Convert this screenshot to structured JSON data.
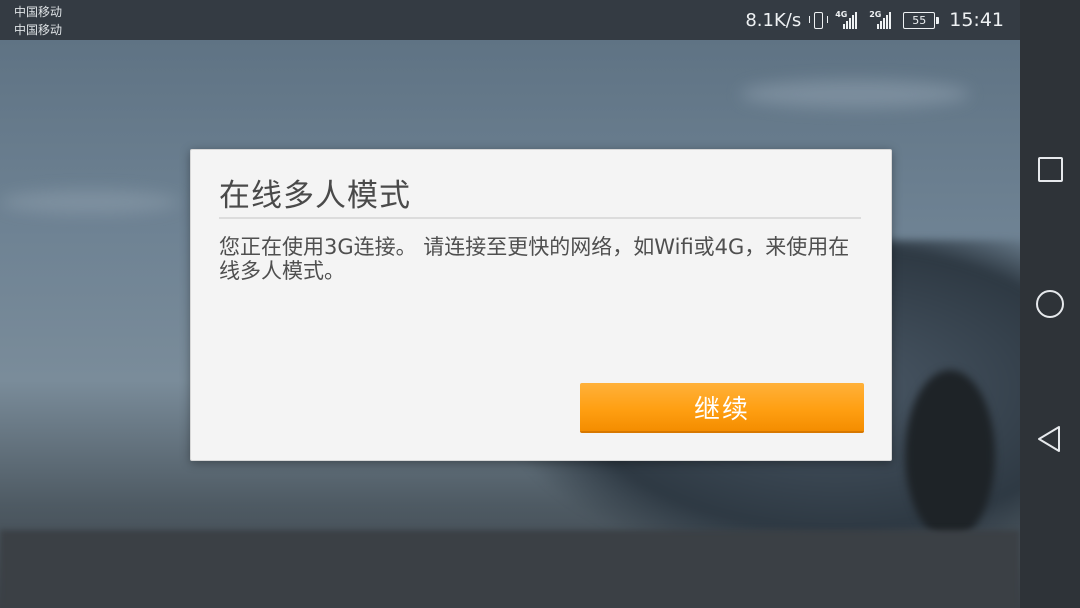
{
  "status_bar": {
    "carrier_1": "中国移动",
    "carrier_2": "中国移动",
    "net_speed": "8.1K/s",
    "sim1_network": "4G",
    "sim2_network": "2G",
    "battery": "55",
    "time": "15:41"
  },
  "dialog": {
    "title": "在线多人模式",
    "message": "您正在使用3G连接。 请连接至更快的网络，如Wifi或4G，来使用在线多人模式。",
    "continue_label": "继续"
  },
  "nav_bar": {
    "icons": [
      "recent-apps-icon",
      "home-icon",
      "back-icon"
    ]
  },
  "colors": {
    "button_accent": "#ffa41e",
    "dialog_bg": "#f4f4f4",
    "status_bar_bg": "#343b43"
  }
}
